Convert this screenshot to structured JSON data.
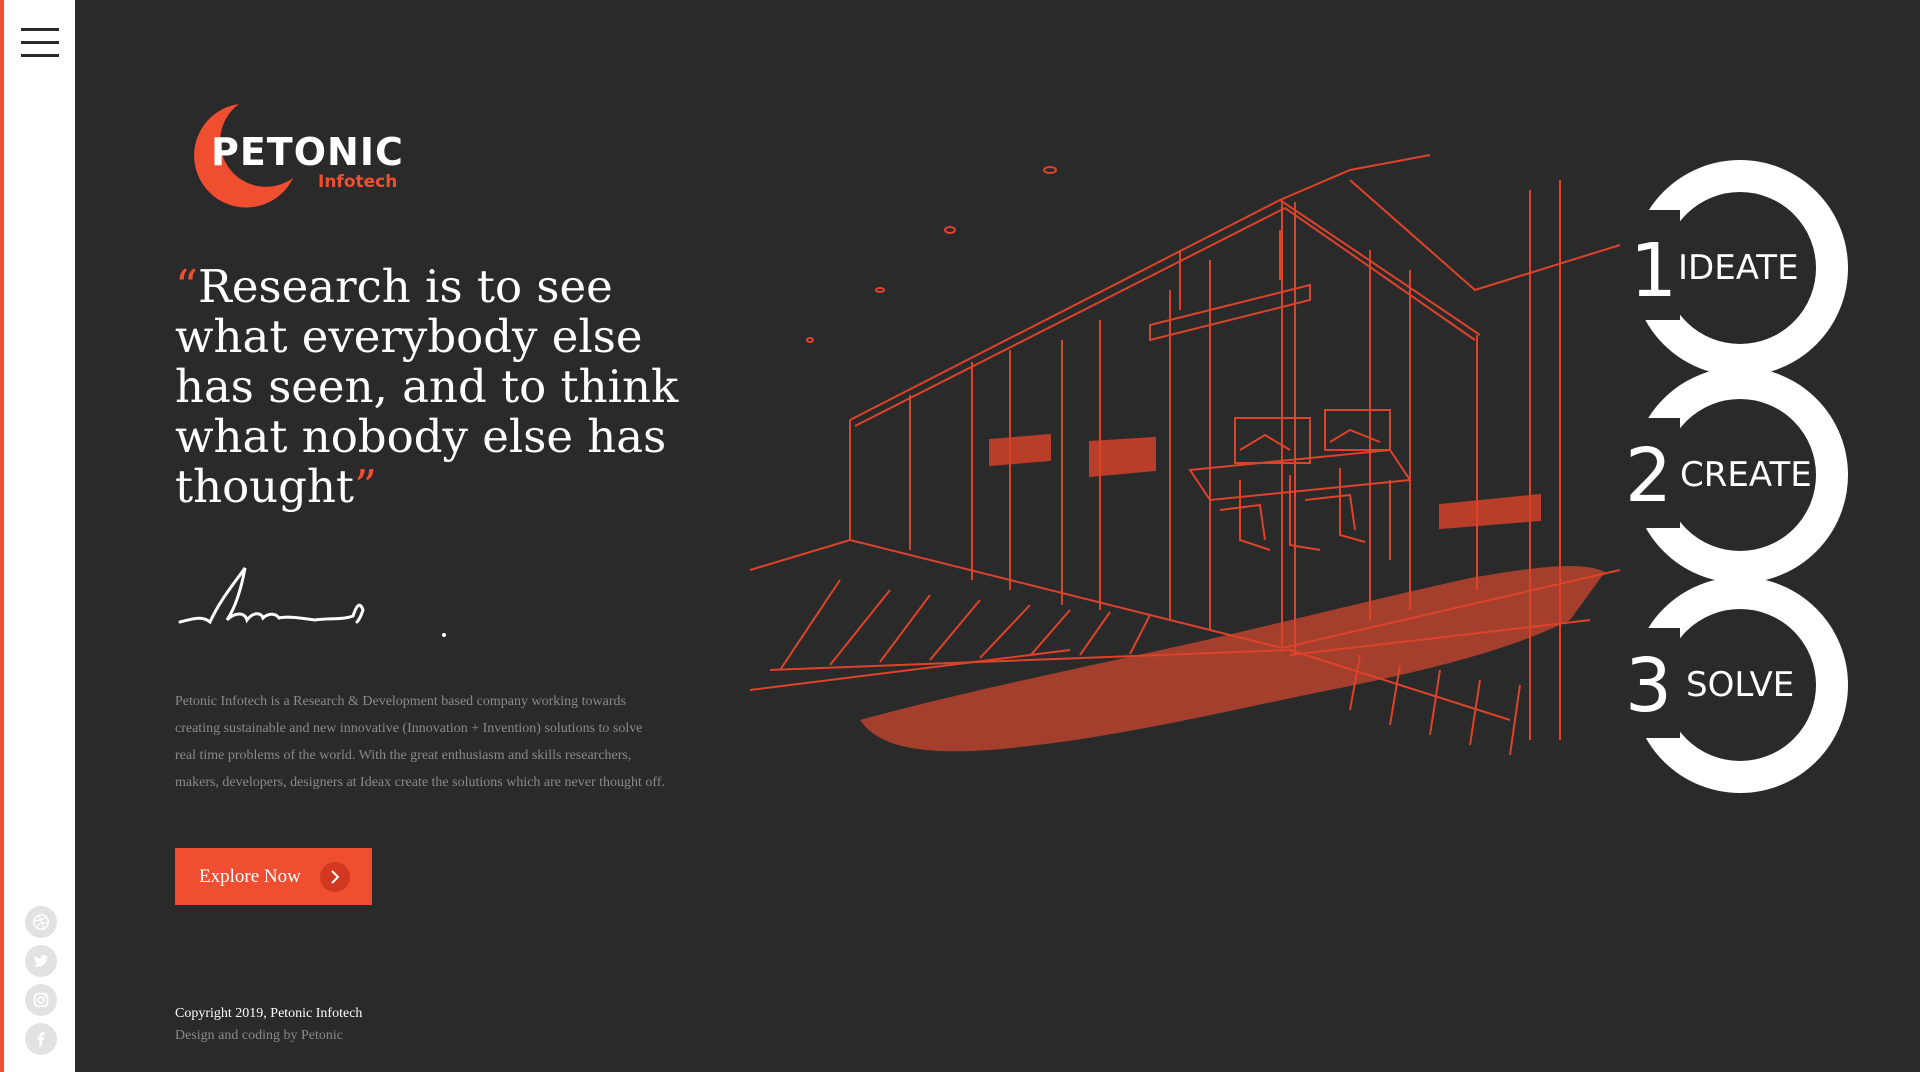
{
  "sidebar": {
    "menu_icon": "hamburger-icon",
    "social_icons": [
      "dribbble-icon",
      "twitter-icon",
      "instagram-icon",
      "facebook-icon"
    ]
  },
  "logo": {
    "brand": "PETONIC",
    "sub": "Infotech"
  },
  "quote": {
    "open_mark": "“",
    "text": "Research is to see what everybody else has seen, and to think what nobody else has thought",
    "close_mark": "”"
  },
  "description": "Petonic Infotech is a Research & Development based company working towards creating sustainable and new innovative (Innovation + Invention) solutions to solve real time problems of the world. With the great enthusiasm and skills researchers, makers, developers, designers at Ideax create the solutions which are never thought off.",
  "cta": {
    "label": "Explore Now",
    "icon": "chevron-right-icon"
  },
  "footer": {
    "copyright": "Copyright 2019, Petonic Infotech",
    "credits": "Design and coding by Petonic"
  },
  "steps": [
    {
      "number": "1",
      "label": "IDEATE"
    },
    {
      "number": "2",
      "label": "CREATE"
    },
    {
      "number": "3",
      "label": "SOLVE"
    }
  ],
  "colors": {
    "accent": "#f04e30",
    "background": "#2a2a2a",
    "sidebar": "#ffffff"
  }
}
